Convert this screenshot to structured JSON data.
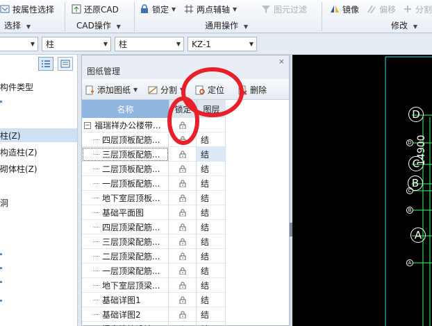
{
  "ribbon": {
    "items": {
      "select_by_attr": "按属性选择",
      "restore_cad": "还原CAD",
      "lock": "锁定",
      "two_point_axis": "两点辅轴",
      "layer_filter": "图元过滤",
      "mirror": "镜像",
      "offset": "偏移",
      "split": "分割"
    },
    "groups": {
      "select": "选择",
      "cad_ops": "CAD操作",
      "common_ops": "通用操作",
      "modify": "修改"
    }
  },
  "combobar": {
    "combo1": "",
    "combo2": "柱",
    "combo3": "柱",
    "combo4": "KZ-1"
  },
  "left_panel": {
    "items": [
      "构件类型",
      "柱(Z)",
      "构造柱(Z)",
      "砌体柱(Z)",
      "洞"
    ]
  },
  "drawing_manager": {
    "title": "图纸管理",
    "close": "×",
    "toolbar": {
      "add": "添加图纸",
      "split": "分割",
      "locate": "定位",
      "delete": "删除"
    },
    "headers": {
      "name": "名称",
      "lock": "锁定",
      "layer": "图层"
    },
    "root": "福瑞祥办公楼带...",
    "rows": [
      {
        "name": "四层顶板配筋...",
        "layer": "结"
      },
      {
        "name": "三层顶板配筋...",
        "layer": "结"
      },
      {
        "name": "二层顶板配筋...",
        "layer": "结"
      },
      {
        "name": "一层顶板配筋...",
        "layer": "结"
      },
      {
        "name": "地下室层顶板...",
        "layer": "结"
      },
      {
        "name": "基础平面图",
        "layer": "结"
      },
      {
        "name": "四层顶梁配筋...",
        "layer": "结"
      },
      {
        "name": "三层顶梁配筋...",
        "layer": "结"
      },
      {
        "name": "二层顶梁配筋...",
        "layer": "结"
      },
      {
        "name": "一层顶梁配筋...",
        "layer": "结"
      },
      {
        "name": "地下室层顶梁...",
        "layer": "结"
      },
      {
        "name": "基础详图1",
        "layer": "结"
      },
      {
        "name": "基础详图2",
        "layer": "结"
      },
      {
        "name": "门窗建筑设计...",
        "layer": "结"
      }
    ]
  },
  "canvas": {
    "axis_labels": [
      "D",
      "C",
      "B",
      "A"
    ],
    "small_labels": [
      "D",
      "C",
      "B",
      "A"
    ],
    "dimension": "14900"
  },
  "colors": {
    "annotation": "#e8202a",
    "header_blue": "#8fb6df",
    "selection": "#cfe0f4",
    "canvas_bg": "#000000",
    "cad_green": "#33ff66",
    "cad_cyan": "#33e0e0"
  }
}
